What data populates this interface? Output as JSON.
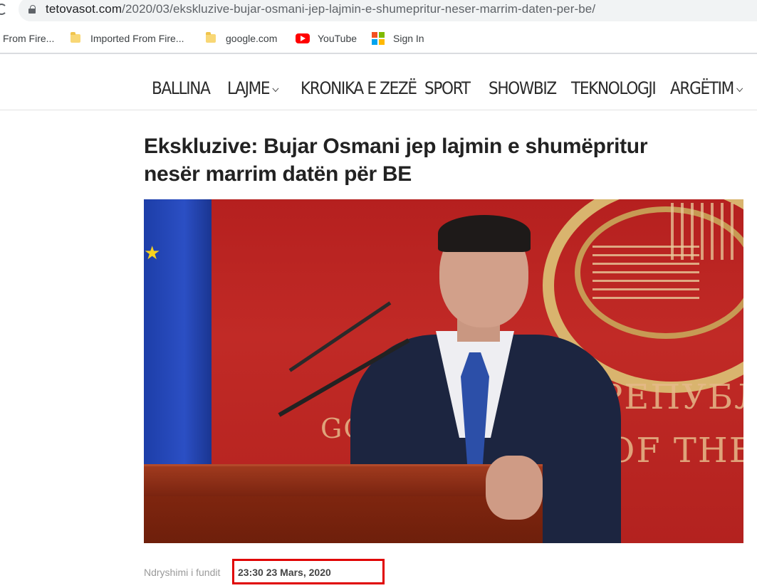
{
  "browser": {
    "url_host": "tetovasot.com",
    "url_path": "/2020/03/ekskluzive-bujar-osmani-jep-lajmin-e-shumepritur-neser-marrim-daten-per-be/",
    "bookmarks": [
      {
        "label": "From Fire...",
        "icon": "folder-icon"
      },
      {
        "label": "Imported From Fire...",
        "icon": "folder-icon"
      },
      {
        "label": "google.com",
        "icon": "folder-icon"
      },
      {
        "label": "YouTube",
        "icon": "youtube-icon"
      },
      {
        "label": "Sign In",
        "icon": "microsoft-icon"
      }
    ]
  },
  "nav": {
    "items": [
      {
        "label": "BALLINA"
      },
      {
        "label": "LAJME",
        "dropdown": true
      },
      {
        "label": "KRONIKA E ZEZË"
      },
      {
        "label": "SPORT"
      },
      {
        "label": "SHOWBIZ"
      },
      {
        "label": "TEKNOLOGJI"
      },
      {
        "label": "ARGËTIM",
        "dropdown": true
      }
    ]
  },
  "article": {
    "title": "Ekskluzive: Bujar Osmani jep lajmin e shumëpritur nesër marrim datën për BE",
    "image_text": [
      "РЕПУБЛИ",
      "OF THE R",
      "GO"
    ],
    "meta_label": "Ndryshimi i fundit",
    "meta_date": "23:30 23 Mars, 2020"
  },
  "colors": {
    "highlight": "#e00000",
    "flag_blue": "#2b4fc4",
    "backdrop_red": "#c12a26"
  }
}
